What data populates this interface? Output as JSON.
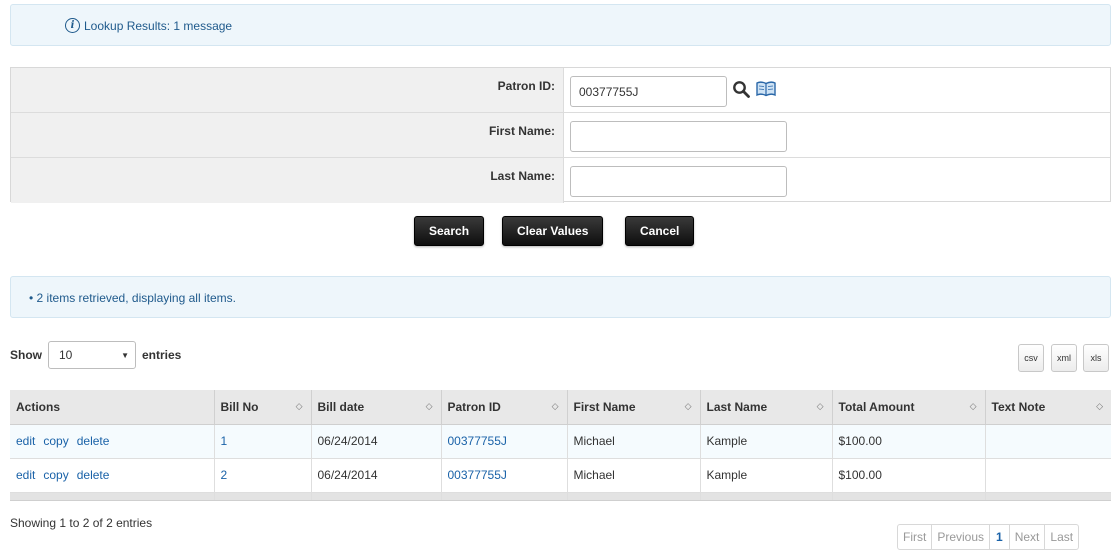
{
  "lookup_message": "Lookup Results: 1 message",
  "form": {
    "patron_id_label": "Patron ID:",
    "patron_id_value": "00377755J",
    "first_name_label": "First Name:",
    "first_name_value": "",
    "last_name_label": "Last Name:",
    "last_name_value": ""
  },
  "buttons": {
    "search": "Search",
    "clear": "Clear Values",
    "cancel": "Cancel"
  },
  "retrieved_message": "• 2 items retrieved, displaying all items.",
  "length_control": {
    "show_label": "Show",
    "selected": "10",
    "entries_label": "entries"
  },
  "export": {
    "csv": "csv",
    "xml": "xml",
    "xls": "xls"
  },
  "table": {
    "headers": [
      "Actions",
      "Bill No",
      "Bill date",
      "Patron ID",
      "First Name",
      "Last Name",
      "Total Amount",
      "Text Note"
    ],
    "rows": [
      {
        "edit": "edit",
        "copy": "copy",
        "delete": "delete",
        "bill_no": "1",
        "bill_date": "06/24/2014",
        "patron_id": "00377755J",
        "first_name": "Michael",
        "last_name": "Kample",
        "total": "$100.00",
        "note": ""
      },
      {
        "edit": "edit",
        "copy": "copy",
        "delete": "delete",
        "bill_no": "2",
        "bill_date": "06/24/2014",
        "patron_id": "00377755J",
        "first_name": "Michael",
        "last_name": "Kample",
        "total": "$100.00",
        "note": ""
      }
    ]
  },
  "info": "Showing 1 to 2 of 2 entries",
  "pager": {
    "first": "First",
    "previous": "Previous",
    "current": "1",
    "next": "Next",
    "last": "Last"
  },
  "colors": {
    "link": "#1a62a8",
    "info_bg": "#eef6fb",
    "button_bg": "#111111"
  }
}
